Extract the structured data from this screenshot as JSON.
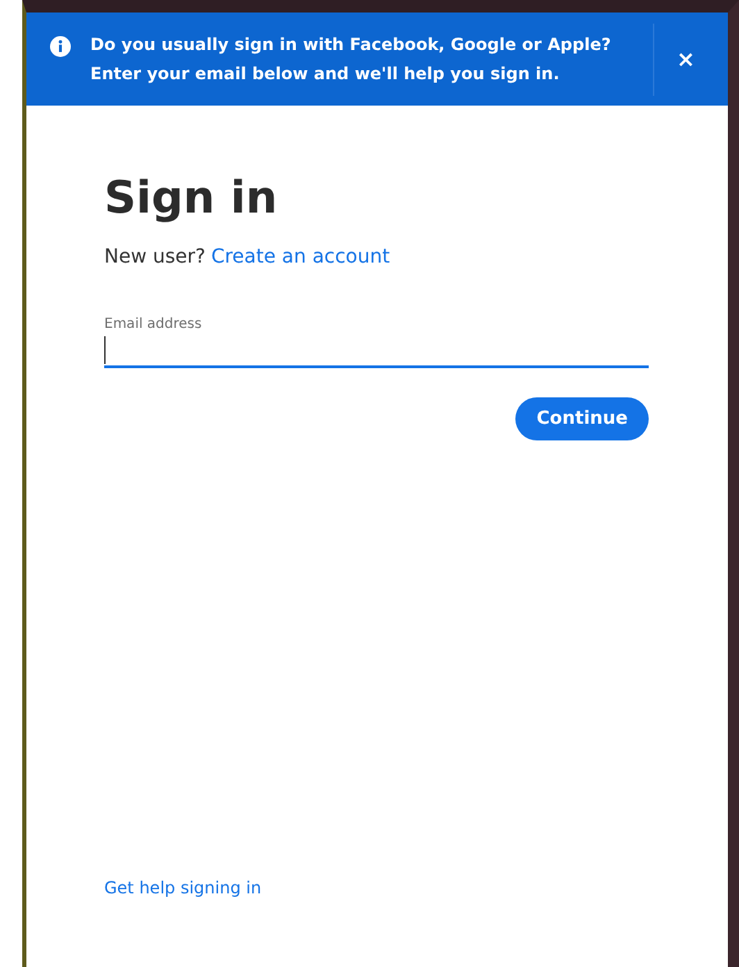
{
  "banner": {
    "message": "Do you usually sign in with Facebook, Google or Apple? Enter your email below and we'll help you sign in.",
    "close": "×"
  },
  "title": "Sign in",
  "new_user": {
    "prompt": "New user?",
    "link": "Create an account"
  },
  "email_field": {
    "label": "Email address",
    "focused": true
  },
  "buttons": [
    {
      "label": "Continue"
    }
  ],
  "help_link": "Get help signing in"
}
